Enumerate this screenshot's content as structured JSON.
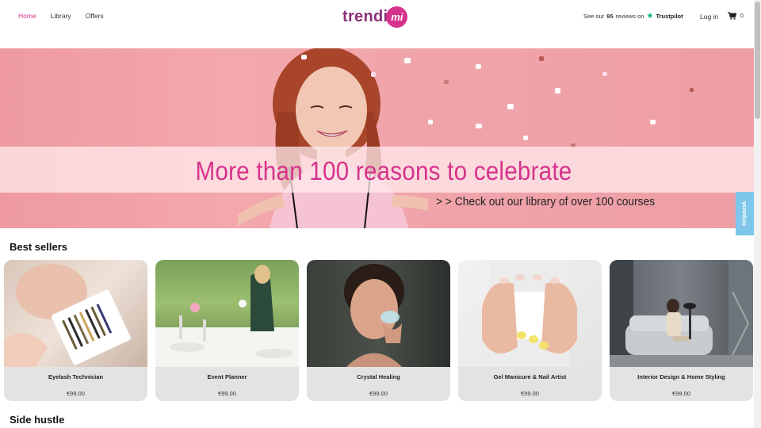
{
  "nav": {
    "home": "Home",
    "library": "Library",
    "offers": "Offers"
  },
  "logo": {
    "word": "trendi",
    "badge": "mi"
  },
  "trustpilot": {
    "prefix": "See our",
    "count": "95",
    "suffix": "reviews on",
    "brand": "Trustpilot"
  },
  "header": {
    "login": "Log in",
    "cart_count": "0"
  },
  "hero": {
    "headline": "More than 100 reasons to celebrate",
    "subline": "> > Check out our library of over 100 courses"
  },
  "helpdesk": "Helpdesk",
  "sections": {
    "best_sellers": "Best sellers",
    "side_hustle": "Side hustle"
  },
  "products": [
    {
      "name": "Eyelash Technician",
      "price": "€99.00"
    },
    {
      "name": "Event Planner",
      "price": "€99.00"
    },
    {
      "name": "Crystal Healing",
      "price": "€99.00"
    },
    {
      "name": "Gel Manicure & Nail Artist",
      "price": "€99.00"
    },
    {
      "name": "Interior Design & Home Styling",
      "price": "€99.00"
    }
  ],
  "colors": {
    "accent": "#d6338c",
    "logo": "#8a2f77",
    "trustpilot_star": "#00b67a",
    "helpdesk": "#7ec6ea",
    "card_bg": "#e3e3e3"
  },
  "icons": [
    "shopping-cart-icon",
    "star-icon"
  ]
}
